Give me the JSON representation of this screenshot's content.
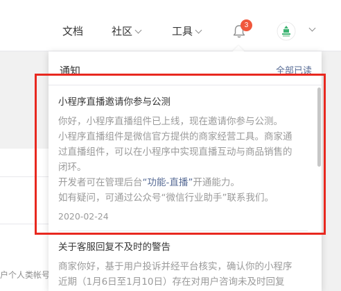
{
  "nav": {
    "docs": "文档",
    "community": "社区",
    "tools": "工具",
    "notification_count": "3"
  },
  "background": {
    "fragment_text": "户个人类帐号"
  },
  "panel": {
    "title": "通知",
    "read_all": "全部已读",
    "items": [
      {
        "title": "小程序直播邀请你参与公测",
        "lines": [
          "你好，小程序直播组件已上线，现在邀请你参与公测。",
          "小程序直播组件是微信官方提供的商家经营工具。商家通",
          "过直播组件，可以在小程序中实现直播互动与商品销售的",
          "闭环。"
        ],
        "line5_prefix": "开发者可在管理后台",
        "line5_link": "“功能-直播”",
        "line5_suffix": "开通能力。",
        "line6": "如有疑问，可通过公众号“微信行业助手”联系我们。",
        "date": "2020-02-24"
      },
      {
        "title": "关于客服回复不及时的警告",
        "lines": [
          "商家你好，基于用户投诉并经平台核实，确认你的小程序",
          "近期（1月6日至1月10日）存在对用户咨询未及时回复"
        ]
      }
    ]
  },
  "colors": {
    "badge": "#f0573c",
    "link": "#576b95",
    "highlight": "#e8281f",
    "avatar_green": "#3cb371"
  }
}
